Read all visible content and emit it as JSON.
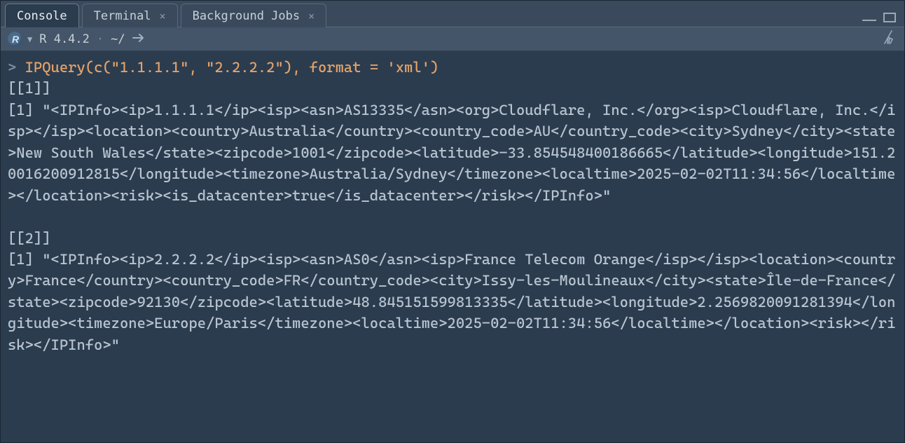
{
  "tabs": {
    "console": "Console",
    "terminal": "Terminal",
    "background": "Background Jobs"
  },
  "status": {
    "r_letter": "R",
    "version": "R 4.4.2",
    "cwd": "~/"
  },
  "console": {
    "prompt": ">",
    "command": "IPQuery(c(\"1.1.1.1\", \"2.2.2.2\"), format = 'xml')",
    "out_header_1": "[[1]]",
    "out_body_1": "[1] \"<IPInfo><ip>1.1.1.1</ip><isp><asn>AS13335</asn><org>Cloudflare, Inc.</org><isp>Cloudflare, Inc.</isp></isp><location><country>Australia</country><country_code>AU</country_code><city>Sydney</city><state>New South Wales</state><zipcode>1001</zipcode><latitude>-33.854548400186665</latitude><longitude>151.20016200912815</longitude><timezone>Australia/Sydney</timezone><localtime>2025-02-02T11:34:56</localtime></location><risk><is_datacenter>true</is_datacenter></risk></IPInfo>\"",
    "out_header_2": "[[2]]",
    "out_body_2": "[1] \"<IPInfo><ip>2.2.2.2</ip><isp><asn>AS0</asn><isp>France Telecom Orange</isp></isp><location><country>France</country><country_code>FR</country_code><city>Issy-les-Moulineaux</city><state>Île-de-France</state><zipcode>92130</zipcode><latitude>48.845151599813335</latitude><longitude>2.2569820091281394</longitude><timezone>Europe/Paris</timezone><localtime>2025-02-02T11:34:56</localtime></location><risk></risk></IPInfo>\""
  }
}
